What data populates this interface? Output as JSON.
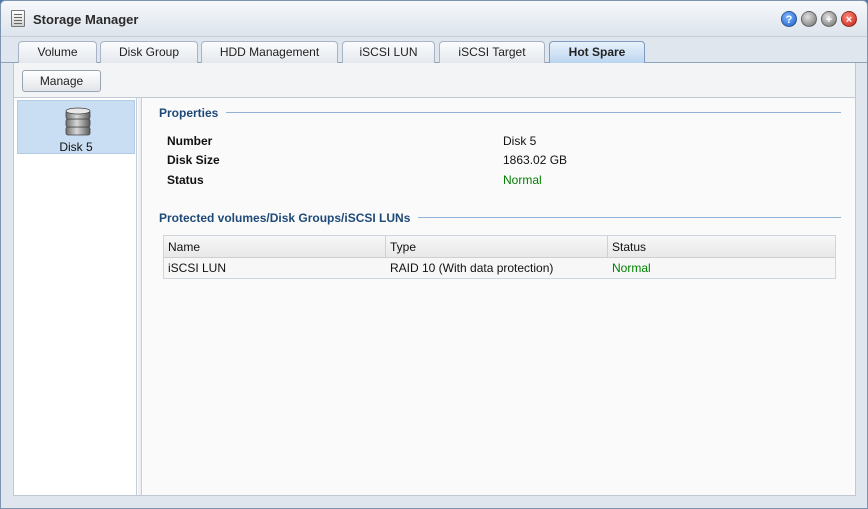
{
  "window": {
    "title": "Storage Manager"
  },
  "window_buttons": {
    "help": "?",
    "minimize": "",
    "maximize": "+",
    "close": "×"
  },
  "tabs": [
    {
      "label": "Volume",
      "active": false
    },
    {
      "label": "Disk Group",
      "active": false
    },
    {
      "label": "HDD Management",
      "active": false
    },
    {
      "label": "iSCSI LUN",
      "active": false
    },
    {
      "label": "iSCSI Target",
      "active": false
    },
    {
      "label": "Hot Spare",
      "active": true
    }
  ],
  "toolbar": {
    "manage_label": "Manage"
  },
  "sidebar": {
    "items": [
      {
        "label": "Disk 5",
        "icon": "disk-stack-icon",
        "selected": true
      }
    ]
  },
  "properties": {
    "title": "Properties",
    "rows": [
      {
        "label": "Number",
        "value": "Disk 5"
      },
      {
        "label": "Disk Size",
        "value": "1863.02 GB"
      },
      {
        "label": "Status",
        "value": "Normal"
      }
    ]
  },
  "protected": {
    "title": "Protected volumes/Disk Groups/iSCSI LUNs",
    "columns": [
      "Name",
      "Type",
      "Status"
    ],
    "rows": [
      {
        "name": "iSCSI LUN",
        "type": "RAID 10 (With data protection)",
        "status": "Normal"
      }
    ]
  },
  "colors": {
    "accent": "#1f4a78",
    "status_normal": "#008000",
    "selection": "#c9ddf3"
  }
}
